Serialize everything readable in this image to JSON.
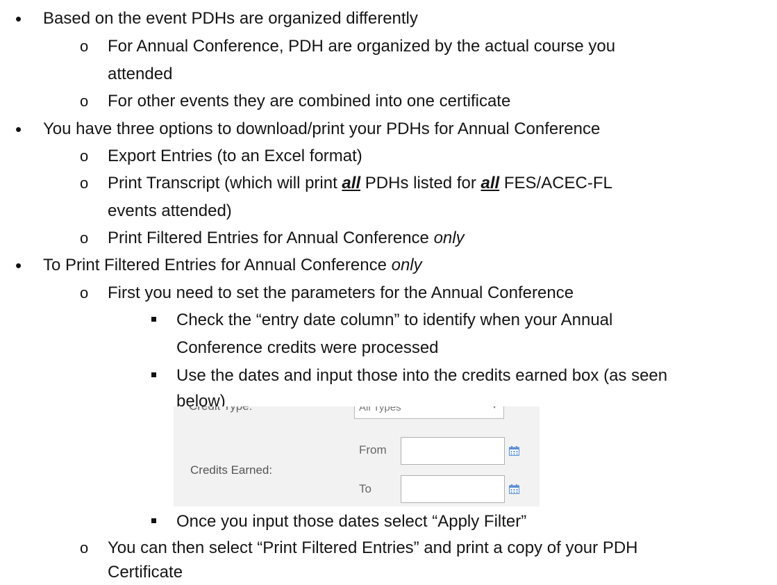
{
  "lines": [
    "Based on the event PDHs are organized differently",
    "For Annual Conference, PDH are organized by the actual course you",
    "attended",
    "For other events they are combined into one certificate",
    "You have three options to download/print your PDHs for Annual Conference",
    "Export Entries (to an Excel format)",
    "Print Transcript (which will print ",
    "all",
    " PDHs listed for ",
    "all",
    " FES/ACEC-FL",
    "events attended)",
    "Print Filtered Entries for Annual Conference ",
    "only",
    "To Print Filtered Entries for Annual Conference ",
    "only",
    "First you need to set the parameters for the Annual Conference",
    "Check the “entry date column” to identify when your Annual",
    "Conference credits were processed",
    "Use the dates and input those into the credits earned box (as seen",
    "below)",
    "Once you input those dates select “Apply Filter”",
    "You can then select “Print Filtered Entries” and print a copy of your PDH",
    "Certificate"
  ],
  "screenshot": {
    "credit_type_label": "Credit Type:",
    "credit_type_value": "All Types",
    "credits_earned_label": "Credits Earned:",
    "from_label": "From",
    "to_label": "To",
    "from_value": "",
    "to_value": ""
  }
}
